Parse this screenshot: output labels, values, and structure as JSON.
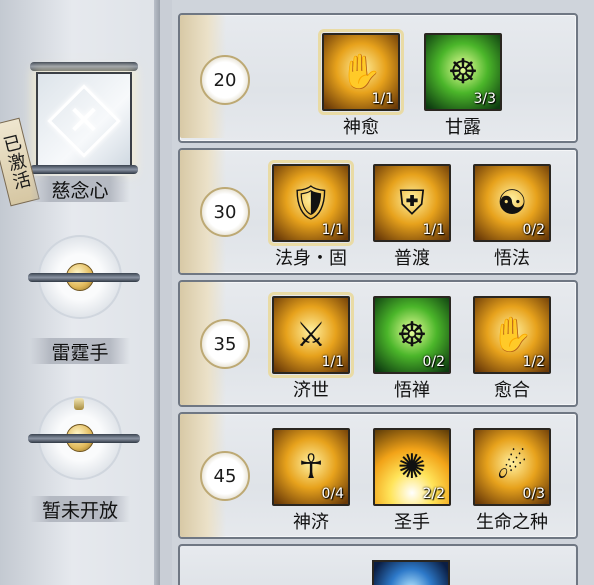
{
  "left_panel": {
    "nodes": [
      {
        "label": "慈念心",
        "icon": "crossed-blades-icon",
        "status_tag": "已激活"
      },
      {
        "label": "雷霆手",
        "icon": "lock-icon"
      },
      {
        "label": "暂未开放",
        "icon": "lock-icon"
      }
    ]
  },
  "tiers": [
    {
      "level": "20",
      "skills": [
        {
          "name": "神愈",
          "count": "1/1",
          "style": "gold",
          "icon": "prayer-hand-icon",
          "selected": true
        },
        {
          "name": "甘露",
          "count": "3/3",
          "style": "green",
          "icon": "meditating-monk-icon"
        }
      ]
    },
    {
      "level": "30",
      "skills": [
        {
          "name": "法身・固",
          "count": "1/1",
          "style": "gold",
          "icon": "monk-shield-icon",
          "selected": true
        },
        {
          "name": "普渡",
          "count": "1/1",
          "style": "gold",
          "icon": "emblem-icon"
        },
        {
          "name": "悟法",
          "count": "0/2",
          "style": "gold",
          "icon": "monk-aura-icon"
        }
      ]
    },
    {
      "level": "35",
      "skills": [
        {
          "name": "济世",
          "count": "1/1",
          "style": "gold",
          "icon": "monk-staff-icon",
          "selected": true
        },
        {
          "name": "悟禅",
          "count": "0/2",
          "style": "green",
          "icon": "meditating-monk-icon"
        },
        {
          "name": "愈合",
          "count": "1/2",
          "style": "gold",
          "icon": "prayer-hand-icon"
        }
      ]
    },
    {
      "level": "45",
      "skills": [
        {
          "name": "神济",
          "count": "0/4",
          "style": "gold",
          "icon": "monk-kneel-icon"
        },
        {
          "name": "圣手",
          "count": "2/2",
          "style": "sun",
          "icon": "light-burst-icon"
        },
        {
          "name": "生命之种",
          "count": "0/3",
          "style": "gold",
          "icon": "leaping-monk-icon"
        }
      ]
    }
  ]
}
